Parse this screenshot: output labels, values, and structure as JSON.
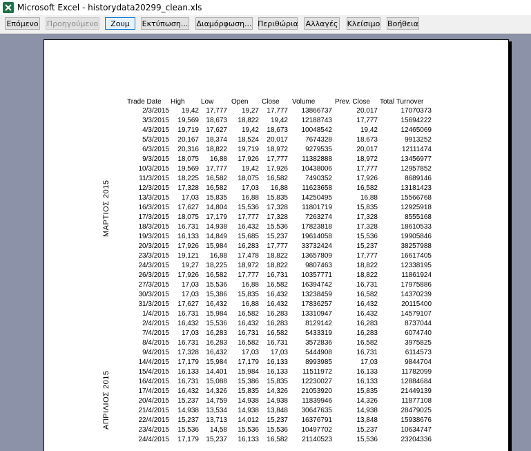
{
  "window": {
    "title": "Microsoft Excel - historydata20299_clean.xls"
  },
  "toolbar": {
    "next": "Επόμενο",
    "previous": "Προηγούμενο",
    "zoom": "Ζουμ",
    "print": "Εκτύπωση...",
    "setup": "Διαμόρφωση...",
    "margins": "Περιθώρια",
    "page_break": "Αλλαγές",
    "close": "Κλείσιμο",
    "help": "Βοήθεια"
  },
  "sheet": {
    "headers": [
      "Trade Date",
      "High",
      "Low",
      "Open",
      "Close",
      "Volume",
      "Prev. Close",
      "Total Turnover"
    ],
    "month_labels": [
      "ΜΑΡΤΙΟΣ 2015",
      "ΑΠΡΙΛΙΟΣ 2015"
    ],
    "rows": [
      [
        "2/3/2015",
        "19,42",
        "17,777",
        "19,27",
        "17,777",
        "13866737",
        "20,017",
        "17070373"
      ],
      [
        "3/3/2015",
        "19,569",
        "18,673",
        "18,822",
        "19,42",
        "12188743",
        "17,777",
        "15694222"
      ],
      [
        "4/3/2015",
        "19,719",
        "17,627",
        "19,42",
        "18,673",
        "10048542",
        "19,42",
        "12465069"
      ],
      [
        "5/3/2015",
        "20,167",
        "18,374",
        "18,524",
        "20,017",
        "7674328",
        "18,673",
        "9913252"
      ],
      [
        "6/3/2015",
        "20,316",
        "18,822",
        "19,719",
        "18,972",
        "9279535",
        "20,017",
        "12111474"
      ],
      [
        "9/3/2015",
        "18,075",
        "16,88",
        "17,926",
        "17,777",
        "11382888",
        "18,972",
        "13456977"
      ],
      [
        "10/3/2015",
        "19,569",
        "17,777",
        "19,42",
        "17,926",
        "10438006",
        "17,777",
        "12957852"
      ],
      [
        "11/3/2015",
        "18,225",
        "16,582",
        "18,075",
        "16,582",
        "7490352",
        "17,926",
        "8689146"
      ],
      [
        "12/3/2015",
        "17,328",
        "16,582",
        "17,03",
        "16,88",
        "11623658",
        "16,582",
        "13181423"
      ],
      [
        "13/3/2015",
        "17,03",
        "15,835",
        "16,88",
        "15,835",
        "14250495",
        "16,88",
        "15566768"
      ],
      [
        "16/3/2015",
        "17,627",
        "14,804",
        "15,536",
        "17,328",
        "11801719",
        "15,835",
        "12925918"
      ],
      [
        "17/3/2015",
        "18,075",
        "17,179",
        "17,777",
        "17,328",
        "7263274",
        "17,328",
        "8555168"
      ],
      [
        "18/3/2015",
        "16,731",
        "14,938",
        "16,432",
        "15,536",
        "17823818",
        "17,328",
        "18610533"
      ],
      [
        "19/3/2015",
        "16,133",
        "14,849",
        "15,685",
        "15,237",
        "19614058",
        "15,536",
        "19905846"
      ],
      [
        "20/3/2015",
        "17,926",
        "15,984",
        "16,283",
        "17,777",
        "33732424",
        "15,237",
        "38257988"
      ],
      [
        "23/3/2015",
        "19,121",
        "16,88",
        "17,478",
        "18,822",
        "13657809",
        "17,777",
        "16617405"
      ],
      [
        "24/3/2015",
        "19,27",
        "18,225",
        "18,972",
        "18,822",
        "9807463",
        "18,822",
        "12338195"
      ],
      [
        "26/3/2015",
        "17,926",
        "16,582",
        "17,777",
        "16,731",
        "10357771",
        "18,822",
        "11861924"
      ],
      [
        "27/3/2015",
        "17,03",
        "15,536",
        "16,88",
        "16,582",
        "16394742",
        "16,731",
        "17975886"
      ],
      [
        "30/3/2015",
        "17,03",
        "15,386",
        "15,835",
        "16,432",
        "13238459",
        "16,582",
        "14370239"
      ],
      [
        "31/3/2015",
        "17,627",
        "16,432",
        "16,88",
        "16,432",
        "17836257",
        "16,432",
        "20115400"
      ],
      [
        "1/4/2015",
        "16,731",
        "15,984",
        "16,582",
        "16,283",
        "13310947",
        "16,432",
        "14579107"
      ],
      [
        "2/4/2015",
        "16,432",
        "15,536",
        "16,432",
        "16,283",
        "8129142",
        "16,283",
        "8737044"
      ],
      [
        "7/4/2015",
        "17,03",
        "16,283",
        "16,731",
        "16,582",
        "5433319",
        "16,283",
        "6074740"
      ],
      [
        "8/4/2015",
        "16,731",
        "16,283",
        "16,582",
        "16,731",
        "3572836",
        "16,582",
        "3975825"
      ],
      [
        "9/4/2015",
        "17,328",
        "16,432",
        "17,03",
        "17,03",
        "5444908",
        "16,731",
        "6114573"
      ],
      [
        "14/4/2015",
        "17,179",
        "15,984",
        "17,179",
        "16,133",
        "8993985",
        "17,03",
        "9844704"
      ],
      [
        "15/4/2015",
        "16,133",
        "14,401",
        "15,984",
        "16,133",
        "11511972",
        "16,133",
        "11782099"
      ],
      [
        "16/4/2015",
        "16,731",
        "15,088",
        "15,386",
        "15,835",
        "12230027",
        "16,133",
        "12884684"
      ],
      [
        "17/4/2015",
        "16,432",
        "14,326",
        "15,835",
        "14,326",
        "21053920",
        "15,835",
        "21449139"
      ],
      [
        "20/4/2015",
        "15,237",
        "14,759",
        "14,938",
        "14,938",
        "11839946",
        "14,326",
        "11877108"
      ],
      [
        "21/4/2015",
        "14,938",
        "13,534",
        "14,938",
        "13,848",
        "30647635",
        "14,938",
        "28479025"
      ],
      [
        "22/4/2015",
        "15,237",
        "13,713",
        "14,012",
        "15,237",
        "16376791",
        "13,848",
        "15938676"
      ],
      [
        "23/4/2015",
        "15,536",
        "14,58",
        "15,536",
        "15,536",
        "10497702",
        "15,237",
        "10634747"
      ],
      [
        "24/4/2015",
        "17,179",
        "15,237",
        "16,133",
        "16,582",
        "21140523",
        "15,536",
        "23204336"
      ]
    ]
  }
}
